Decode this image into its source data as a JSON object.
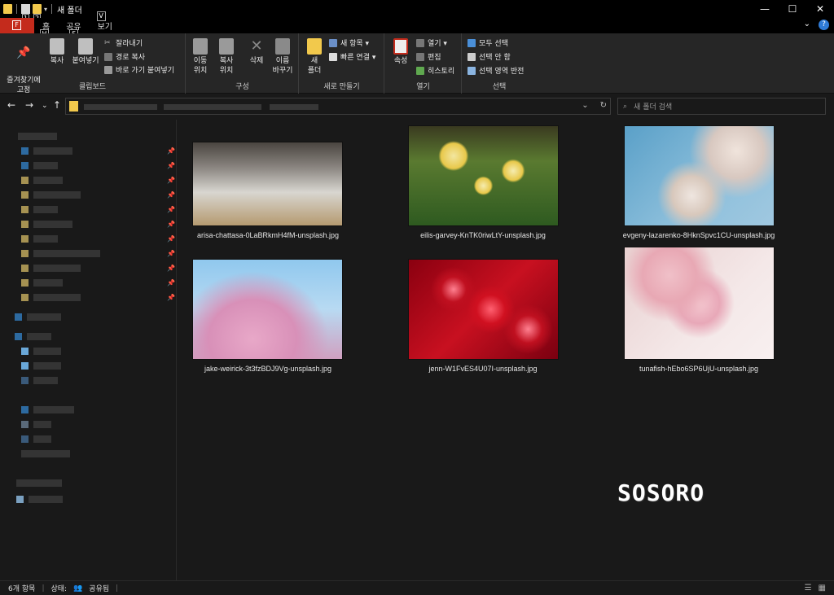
{
  "titlebar": {
    "title": "새 폴더",
    "key1": "1",
    "key2": "2",
    "min": "—",
    "max": "☐",
    "close": "✕"
  },
  "tabs": [
    {
      "label": "",
      "key": "F"
    },
    {
      "label": "홈",
      "key": "H"
    },
    {
      "label": "공유",
      "key": "S"
    },
    {
      "label": "보기",
      "key": "V"
    }
  ],
  "ribbon": {
    "clipboard": {
      "pin": "즐겨찾기에\n고정",
      "copy": "복사",
      "paste": "붙여넣기",
      "cut": "잘라내기",
      "copy_path": "경로 복사",
      "paste_shortcut": "바로 가기 붙여넣기",
      "label": "클립보드"
    },
    "organize": {
      "move": "이동\n위치",
      "copyto": "복사\n위치",
      "delete": "삭제",
      "rename": "이름\n바꾸기",
      "label": "구성"
    },
    "new": {
      "new_folder": "새\n폴더",
      "new_item": "새 항목 ▾",
      "quick_access": "빠른 연결 ▾",
      "label": "새로 만들기"
    },
    "open": {
      "properties": "속성",
      "open": "열기 ▾",
      "edit": "편집",
      "history": "히스토리",
      "label": "열기"
    },
    "select": {
      "select_all": "모두 선택",
      "select_none": "선택 안 함",
      "invert": "선택 영역 반전",
      "label": "선택"
    }
  },
  "search": {
    "placeholder": "새 폴더 검색"
  },
  "files": [
    {
      "name": "arisa-chattasa-0LaBRkmH4fM-unsplash.jpg"
    },
    {
      "name": "eilis-garvey-KnTK0riwLtY-unsplash.jpg"
    },
    {
      "name": "evgeny-lazarenko-8HknSpvc1CU-unsplash.jpg"
    },
    {
      "name": "jake-weirick-3t3fzBDJ9Vg-unsplash.jpg"
    },
    {
      "name": "jenn-W1FvES4U07I-unsplash.jpg"
    },
    {
      "name": "tunafish-hEbo6SP6UjU-unsplash.jpg"
    }
  ],
  "watermark": "SOSORO",
  "status": {
    "count": "6개 항목",
    "state_label": "상태:",
    "state_value": "공유됨"
  }
}
